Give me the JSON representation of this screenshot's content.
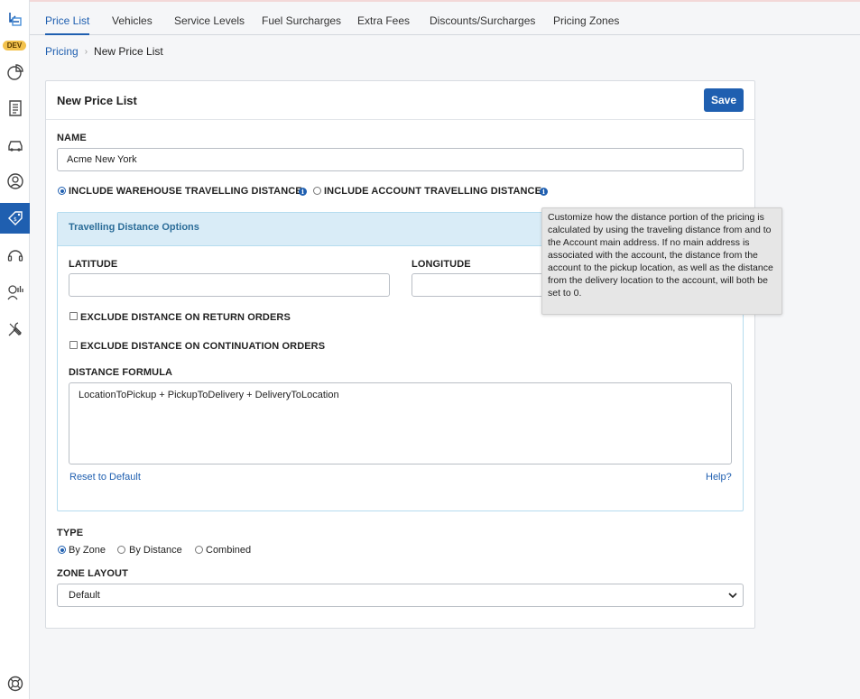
{
  "env_badge": "DEV",
  "tabs": [
    {
      "label": "Price List",
      "active": true
    },
    {
      "label": "Vehicles"
    },
    {
      "label": "Service Levels"
    },
    {
      "label": "Fuel Surcharges"
    },
    {
      "label": "Extra Fees"
    },
    {
      "label": "Discounts/Surcharges"
    },
    {
      "label": "Pricing Zones"
    }
  ],
  "breadcrumb": {
    "parent": "Pricing",
    "current": "New Price List"
  },
  "card": {
    "title": "New Price List",
    "save_label": "Save",
    "name_label": "NAME",
    "name_value": "Acme New York",
    "distance_mode": {
      "warehouse_label": "INCLUDE WAREHOUSE TRAVELLING DISTANCE",
      "account_label": "INCLUDE ACCOUNT TRAVELLING DISTANCE",
      "selected": "warehouse"
    },
    "options": {
      "title": "Travelling Distance Options",
      "latitude_label": "LATITUDE",
      "latitude_value": "",
      "longitude_label": "LONGITUDE",
      "longitude_value": "",
      "exclude_return_label": "EXCLUDE DISTANCE ON RETURN ORDERS",
      "exclude_continuation_label": "EXCLUDE DISTANCE ON CONTINUATION ORDERS",
      "formula_label": "DISTANCE FORMULA",
      "formula_value": "LocationToPickup + PickupToDelivery + DeliveryToLocation",
      "reset_label": "Reset to Default",
      "help_label": "Help?"
    },
    "type": {
      "label": "TYPE",
      "options": [
        "By Zone",
        "By Distance",
        "Combined"
      ],
      "selected": "By Zone"
    },
    "zone_layout": {
      "label": "ZONE LAYOUT",
      "value": "Default"
    }
  },
  "tooltip": {
    "text": "Customize how the distance portion of the pricing is calculated by using the traveling distance from and to the Account main address. If no main address is associated with the account, the distance from the account to the pickup location, as well as the distance from the delivery location to the account, will both be set to 0."
  },
  "sidebar": {
    "icons": [
      "app-logo-icon",
      "analytics-pie-icon",
      "receipt-icon",
      "car-icon",
      "user-circle-icon",
      "price-tag-icon",
      "headset-icon",
      "chart-person-icon",
      "tools-icon",
      "lifebuoy-icon"
    ],
    "active": "price-tag-icon"
  },
  "colors": {
    "accent": "#1f5fb0",
    "panel_head": "#d9ecf7",
    "badge": "#f3c24c"
  }
}
